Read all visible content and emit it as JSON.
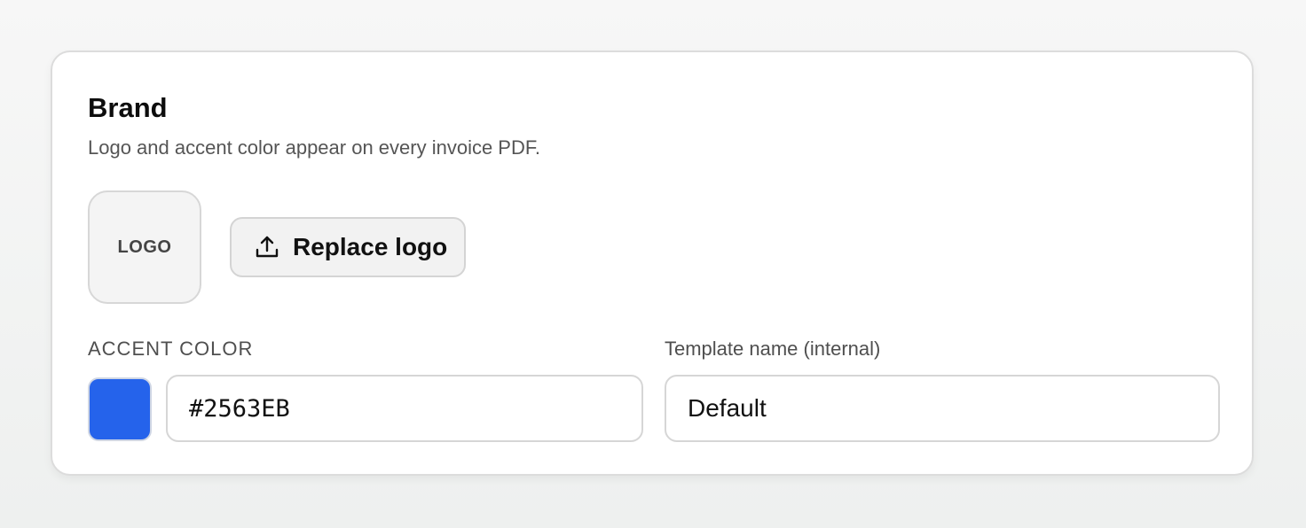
{
  "card": {
    "title": "Brand",
    "subtitle": "Logo and accent color appear on every invoice PDF."
  },
  "logo": {
    "placeholder": "LOGO",
    "replace_label": "Replace logo",
    "replace_icon": "upload-icon"
  },
  "accent": {
    "label": "ACCENT COLOR",
    "value": "#2563EB",
    "swatch_color": "#2563EB"
  },
  "template": {
    "label": "Template name (internal)",
    "value": "Default"
  }
}
